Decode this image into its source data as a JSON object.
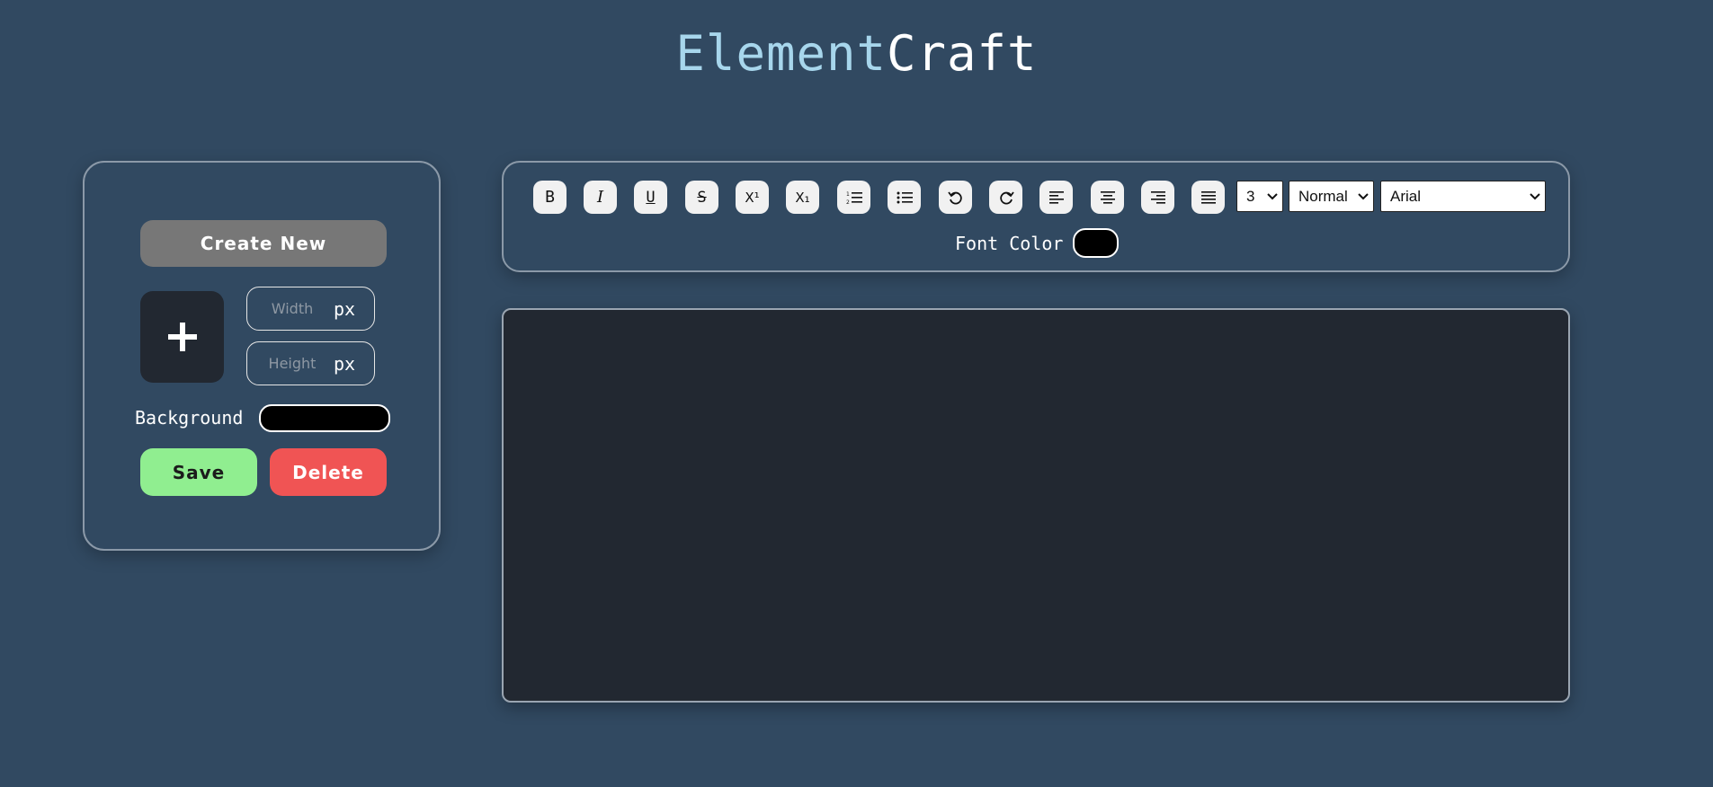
{
  "header": {
    "title_part1": "Element",
    "title_part2": "Craft"
  },
  "left_panel": {
    "create_label": "Create New",
    "add_icon": "plus-icon",
    "width_placeholder": "Width",
    "height_placeholder": "Height",
    "unit": "px",
    "background_label": "Background",
    "background_color": "#000000",
    "save_label": "Save",
    "delete_label": "Delete",
    "colors": {
      "create": "#777777",
      "save": "#90ee90",
      "delete": "#f05454"
    }
  },
  "toolbar": {
    "buttons": [
      {
        "name": "bold",
        "icon": "bold-icon",
        "glyph": "B"
      },
      {
        "name": "italic",
        "icon": "italic-icon",
        "glyph": "I"
      },
      {
        "name": "underline",
        "icon": "underline-icon",
        "glyph": "U"
      },
      {
        "name": "strikethrough",
        "icon": "strikethrough-icon",
        "glyph": "S"
      },
      {
        "name": "superscript",
        "icon": "superscript-icon",
        "glyph": "X¹"
      },
      {
        "name": "subscript",
        "icon": "subscript-icon",
        "glyph": "X₁"
      },
      {
        "name": "ordered-list",
        "icon": "ordered-list-icon"
      },
      {
        "name": "unordered-list",
        "icon": "unordered-list-icon"
      },
      {
        "name": "undo",
        "icon": "undo-icon"
      },
      {
        "name": "redo",
        "icon": "redo-icon"
      },
      {
        "name": "align-left",
        "icon": "align-left-icon"
      },
      {
        "name": "align-center",
        "icon": "align-center-icon"
      },
      {
        "name": "align-right",
        "icon": "align-right-icon"
      },
      {
        "name": "justify",
        "icon": "justify-icon"
      }
    ],
    "font_size_value": "3",
    "format_value": "Normal",
    "font_value": "Arial",
    "font_color_label": "Font Color",
    "font_color": "#000000"
  },
  "editor": {
    "content": ""
  }
}
